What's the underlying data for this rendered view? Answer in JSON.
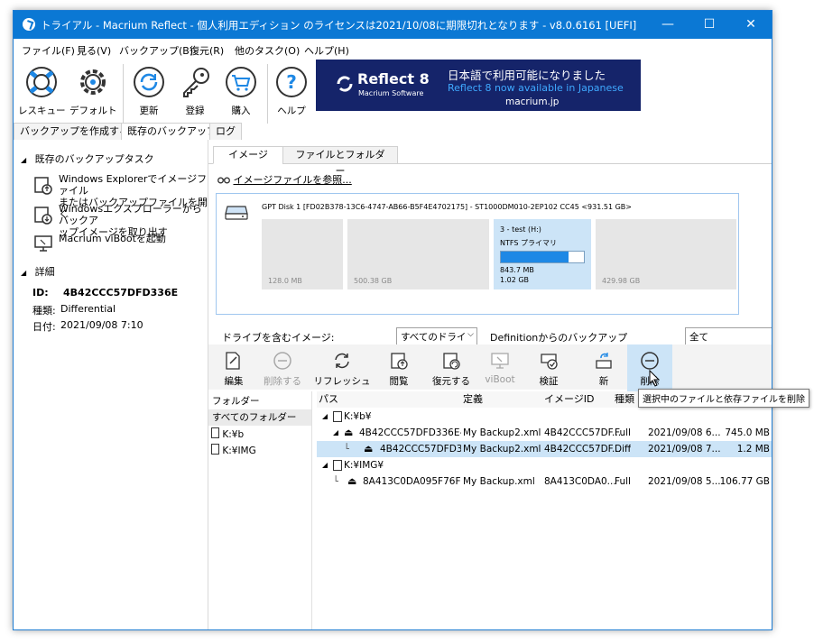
{
  "window": {
    "title": "トライアル - Macrium Reflect - 個人利用エディション のライセンスは2021/10/08に期限切れとなります - v8.0.6161  [UEFI]",
    "minimize": "—",
    "maximize": "☐",
    "close": "✕"
  },
  "menu": [
    "ファイル(F)",
    "見る(V)",
    "バックアップ(B)",
    "復元(R)",
    "他のタスク(O)",
    "ヘルプ(H)"
  ],
  "toolbar": {
    "items": [
      {
        "label": "レスキュー",
        "icon": "lifebuoy-icon"
      },
      {
        "label": "デフォルト",
        "icon": "gear-icon"
      },
      {
        "label": "更新",
        "icon": "refresh-icon"
      },
      {
        "label": "登録",
        "icon": "key-icon"
      },
      {
        "label": "購入",
        "icon": "cart-icon"
      },
      {
        "label": "ヘルプ",
        "icon": "help-icon"
      }
    ]
  },
  "banner": {
    "product": "Reflect 8",
    "company": "Macrium Software",
    "line1": "日本語で利用可能になりました",
    "line2": "Reflect 8 now available in Japanese",
    "url": "macrium.jp"
  },
  "left_tabs": [
    "バックアップを作成する",
    "既存のバックアップ",
    "ログ"
  ],
  "left": {
    "tasks_header": "既存のバックアップタスク",
    "tasks": [
      {
        "line1": "Windows Explorerでイメージファイル",
        "line2": "またはバックアップファイルを開く"
      },
      {
        "line1": "Windowsエクスプローラーからバックア",
        "line2": "ップイメージを取り出す"
      },
      {
        "line1": "Macrium viBootを起動",
        "line2": ""
      }
    ],
    "details_header": "詳細",
    "details": {
      "id_label": "ID:",
      "id_value": "4B42CCC57DFD336E",
      "type_label": "種類:",
      "type_value": "Differential",
      "date_label": "日付:",
      "date_value": "2021/09/08 7:10"
    }
  },
  "right_tabs": [
    "イメージ",
    "ファイルとフォルダー"
  ],
  "browse_link": "イメージファイルを参照...",
  "disk": {
    "title": "GPT Disk 1 [FD02B378-13C6-4747-AB66-B5F4E4702175] - ST1000DM010-2EP102 CC45  <931.51 GB>",
    "partitions": [
      {
        "size": "128.0 MB"
      },
      {
        "size": "500.38 GB"
      },
      {
        "name": "3 - test (H:)",
        "fs": "NTFS プライマリ",
        "used": "843.7 MB",
        "total": "1.02 GB",
        "fill": 0.81
      },
      {
        "size": "429.98 GB"
      }
    ]
  },
  "filter": {
    "drive_label": "ドライブを含むイメージ:",
    "drive_value": "すべてのドライ",
    "definition_label": "Definitionからのバックアップ",
    "definition_value": "全て"
  },
  "actions": [
    {
      "label": "編集",
      "icon": "edit-icon",
      "enabled": true
    },
    {
      "label": "削除する",
      "icon": "minus-circle-icon",
      "enabled": false
    },
    {
      "label": "リフレッシュ",
      "icon": "refresh-icon",
      "enabled": true
    },
    {
      "label": "閲覧",
      "icon": "browse-icon",
      "enabled": true
    },
    {
      "label": "復元する",
      "icon": "restore-icon",
      "enabled": true
    },
    {
      "label": "viBoot",
      "icon": "viboot-icon",
      "enabled": false
    },
    {
      "label": "検証",
      "icon": "verify-icon",
      "enabled": true
    },
    {
      "label": "新",
      "icon": "new-icon",
      "enabled": true
    },
    {
      "label": "削除",
      "icon": "delete-icon",
      "enabled": true
    }
  ],
  "tooltip": "選択中のファイルと依存ファイルを削除",
  "folders": {
    "header": "フォルダー",
    "items": [
      "すべてのフォルダー",
      "K:¥b",
      "K:¥IMG"
    ]
  },
  "table": {
    "columns": [
      "パス",
      "定義",
      "イメージID",
      "種類"
    ],
    "rows": [
      {
        "kind": "folder",
        "path": "K:¥b¥"
      },
      {
        "kind": "file",
        "path": "4B42CCC57DFD336E-...",
        "definition": "My Backup2.xml",
        "id": "4B42CCC57DF...",
        "type": "Full",
        "date": "2021/09/08 6...",
        "size": "745.0 MB"
      },
      {
        "kind": "file",
        "path": "4B42CCC57DFD3...",
        "definition": "My Backup2.xml",
        "id": "4B42CCC57DF...",
        "type": "Diff",
        "date": "2021/09/08 7...",
        "size": "1.2 MB"
      },
      {
        "kind": "folder",
        "path": "K:¥IMG¥"
      },
      {
        "kind": "file",
        "path": "8A413C0DA095F76F-...",
        "definition": "My Backup.xml",
        "id": "8A413C0DA0...",
        "type": "Full",
        "date": "2021/09/08 5...",
        "size": "106.77 GB"
      }
    ]
  },
  "colors": {
    "accent": "#0b78d4",
    "selection": "#cce4f7",
    "banner": "#15246a",
    "partition_selected": "#cce4f7"
  }
}
